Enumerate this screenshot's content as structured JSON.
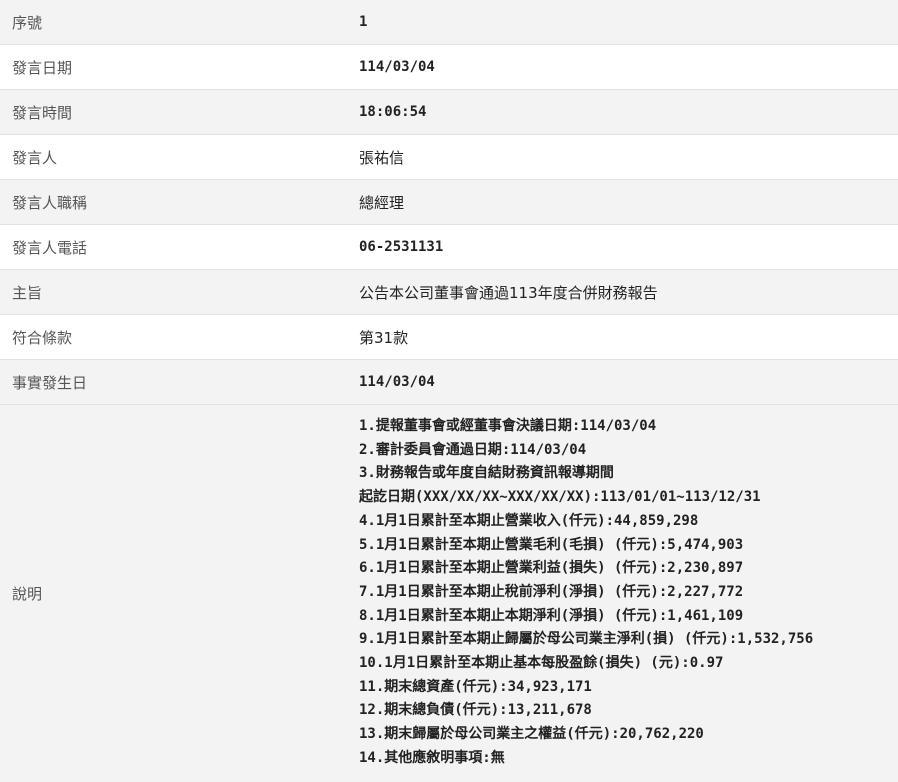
{
  "rows": [
    {
      "label": "序號",
      "value": "1"
    },
    {
      "label": "發言日期",
      "value": "114/03/04"
    },
    {
      "label": "發言時間",
      "value": "18:06:54"
    },
    {
      "label": "發言人",
      "value": "張祐信"
    },
    {
      "label": "發言人職稱",
      "value": "總經理"
    },
    {
      "label": "發言人電話",
      "value": "06-2531131"
    },
    {
      "label": "主旨",
      "value": "公告本公司董事會通過113年度合併財務報告"
    },
    {
      "label": "符合條款",
      "value": "第31款"
    },
    {
      "label": "事實發生日",
      "value": "114/03/04"
    }
  ],
  "description": {
    "label": "說明",
    "lines": [
      "1.提報董事會或經董事會決議日期:114/03/04",
      "2.審計委員會通過日期:114/03/04",
      "3.財務報告或年度自結財務資訊報導期間",
      "起訖日期(XXX/XX/XX~XXX/XX/XX):113/01/01~113/12/31",
      "4.1月1日累計至本期止營業收入(仟元):44,859,298",
      "5.1月1日累計至本期止營業毛利(毛損) (仟元):5,474,903",
      "6.1月1日累計至本期止營業利益(損失) (仟元):2,230,897",
      "7.1月1日累計至本期止稅前淨利(淨損) (仟元):2,227,772",
      "8.1月1日累計至本期止本期淨利(淨損) (仟元):1,461,109",
      "9.1月1日累計至本期止歸屬於母公司業主淨利(損) (仟元):1,532,756",
      "10.1月1日累計至本期止基本每股盈餘(損失) (元):0.97",
      "11.期末總資產(仟元):34,923,171",
      "12.期末總負債(仟元):13,211,678",
      "13.期末歸屬於母公司業主之權益(仟元):20,762,220",
      "14.其他應敘明事項:無"
    ]
  }
}
